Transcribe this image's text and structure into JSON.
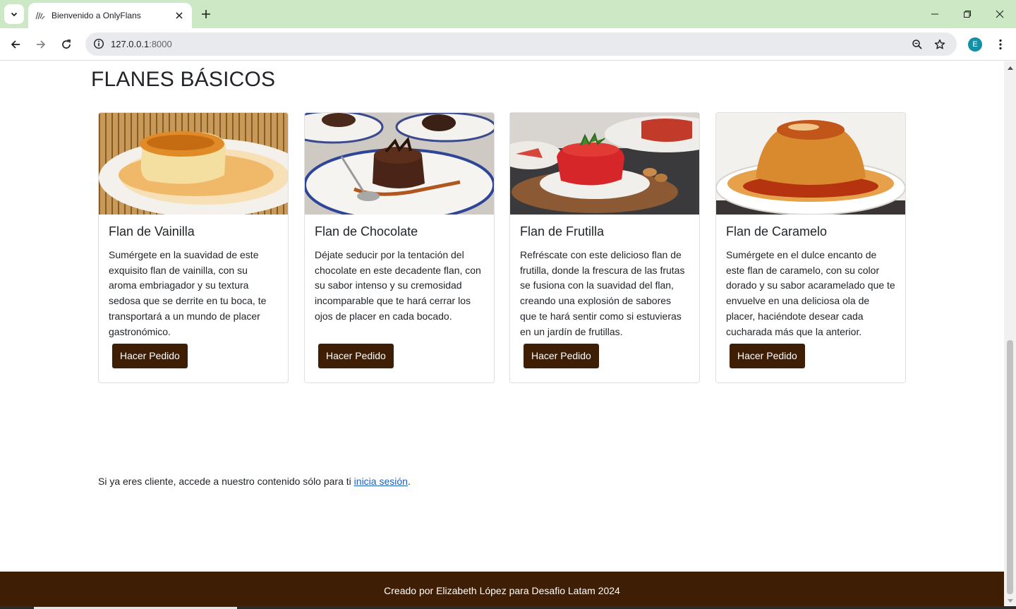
{
  "browser": {
    "tab": {
      "title": "Bienvenido a OnlyFlans"
    },
    "address": {
      "host": "127.0.0.1",
      "port": ":8000"
    },
    "profile_initial": "E",
    "icons": [
      "tab-search-icon",
      "flan-favicon-icon",
      "close-icon",
      "plus-icon",
      "minimize-icon",
      "restore-icon",
      "window-close-icon",
      "back-icon",
      "forward-icon",
      "reload-icon",
      "site-info-icon",
      "zoom-icon",
      "bookmark-star-icon",
      "menu-kebab-icon"
    ]
  },
  "page": {
    "section_title": "FLANES BÁSICOS",
    "cards": [
      {
        "title": "Flan de Vainilla",
        "text": "Sumérgete en la suavidad de este exquisito flan de vainilla, con su aroma embriagador y su textura sedosa que se derrite en tu boca, te transportará a un mundo de placer gastronómico.",
        "button": "Hacer Pedido"
      },
      {
        "title": "Flan de Chocolate",
        "text": "Déjate seducir por la tentación del chocolate en este decadente flan, con su sabor intenso y su cremosidad incomparable que te hará cerrar los ojos de placer en cada bocado.",
        "button": "Hacer Pedido"
      },
      {
        "title": "Flan de Frutilla",
        "text": "Refréscate con este delicioso flan de frutilla, donde la frescura de las frutas se fusiona con la suavidad del flan, creando una explosión de sabores que te hará sentir como si estuvieras en un jardín de frutillas.",
        "button": "Hacer Pedido"
      },
      {
        "title": "Flan de Caramelo",
        "text": "Sumérgete en el dulce encanto de este flan de caramelo, con su color dorado y su sabor acaramelado que te envuelve en una deliciosa ola de placer, haciéndote desear cada cucharada más que la anterior.",
        "button": "Hacer Pedido"
      }
    ],
    "login": {
      "prefix": "Si ya eres cliente, accede a nuestro contenido sólo para ti ",
      "link": "inicia sesión",
      "suffix": "."
    },
    "footer": "Creado por Elizabeth López para Desafio Latam 2024"
  },
  "colors": {
    "tabbar": "#cce8c4",
    "button": "#3e1e05",
    "footer": "#3e1e05",
    "link": "#1a5fc2"
  }
}
